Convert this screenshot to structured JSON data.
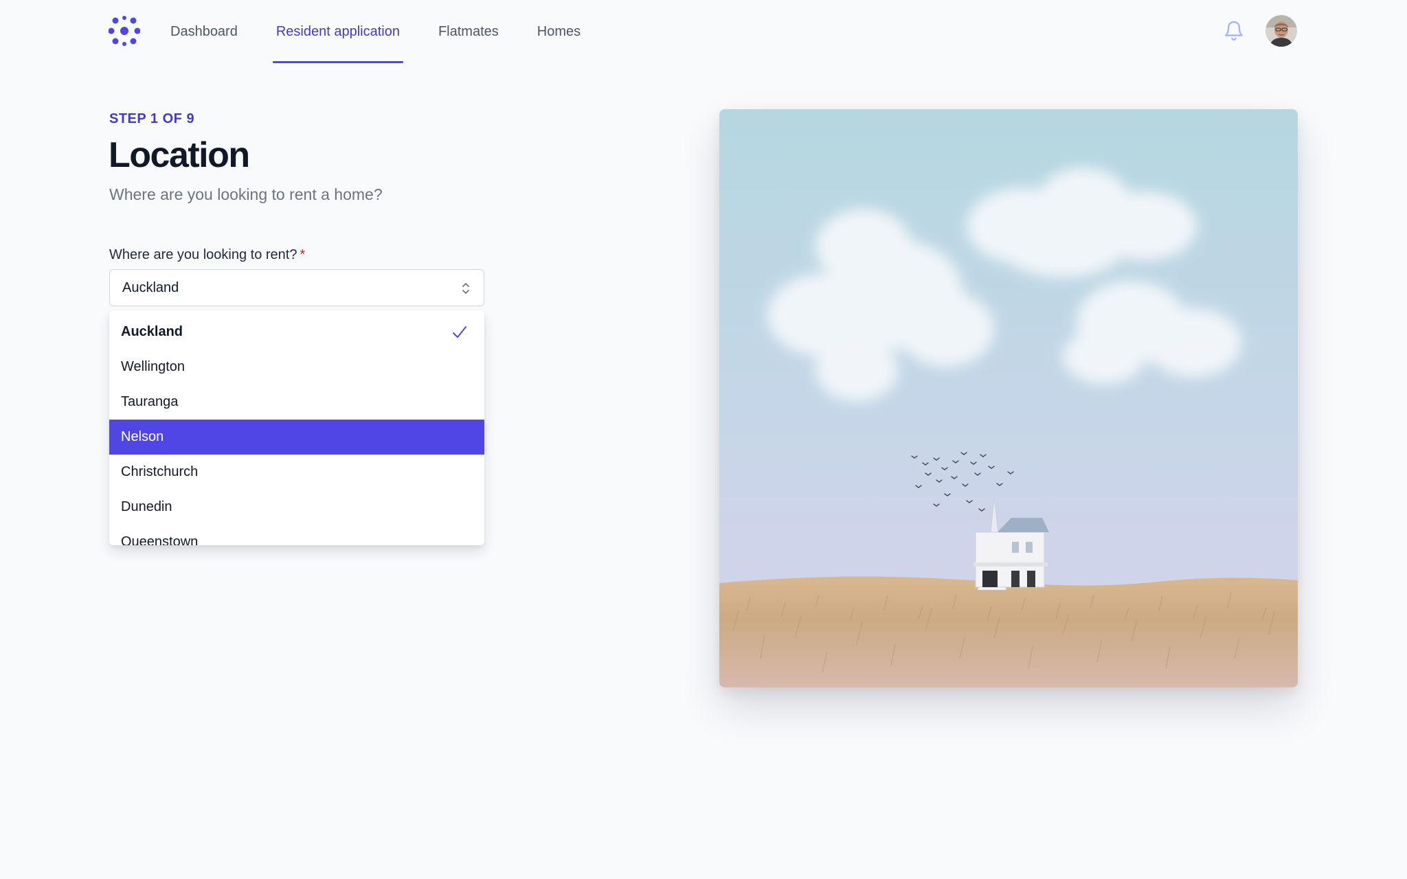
{
  "nav": {
    "links": [
      {
        "label": "Dashboard",
        "active": false
      },
      {
        "label": "Resident application",
        "active": true
      },
      {
        "label": "Flatmates",
        "active": false
      },
      {
        "label": "Homes",
        "active": false
      }
    ],
    "icons": {
      "logo": "logo-icon",
      "notifications": "bell-icon",
      "avatar": "user-avatar"
    }
  },
  "step": {
    "label": "STEP 1 OF 9",
    "title": "Location",
    "subtitle": "Where are you looking to rent a home?"
  },
  "form": {
    "label": "Where are you looking to rent?",
    "required_mark": "*",
    "selected_value": "Auckland",
    "options": [
      "Auckland",
      "Wellington",
      "Tauranga",
      "Nelson",
      "Christchurch",
      "Dunedin",
      "Queenstown"
    ],
    "checked_option": "Auckland",
    "highlighted_option": "Nelson"
  },
  "colors": {
    "accent": "#4f46e5",
    "accent_text": "#4338ca",
    "required": "#dc2626"
  }
}
